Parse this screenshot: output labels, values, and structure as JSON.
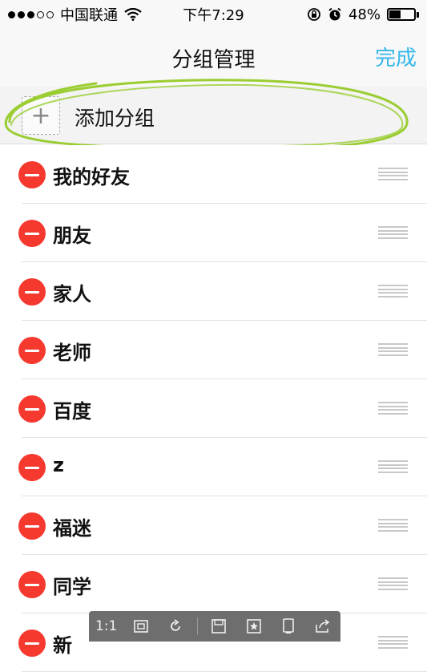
{
  "status_bar": {
    "carrier": "中国联通",
    "time": "下午7:29",
    "battery_percent": "48%",
    "battery_level": 0.48,
    "signal_bars_filled": 3,
    "signal_bars_total": 5,
    "icons": [
      "wifi-icon",
      "rotation-lock-icon",
      "alarm-icon",
      "battery-icon"
    ]
  },
  "nav": {
    "title": "分组管理",
    "done_label": "完成",
    "accent_color": "#35b7ea"
  },
  "add_group": {
    "plus": "+",
    "label": "添加分组"
  },
  "groups": [
    {
      "name": "我的好友"
    },
    {
      "name": "朋友"
    },
    {
      "name": "家人"
    },
    {
      "name": "老师"
    },
    {
      "name": "百度"
    },
    {
      "name": "z"
    },
    {
      "name": "福迷"
    },
    {
      "name": "同学"
    },
    {
      "name": "新"
    }
  ],
  "colors": {
    "delete": "#f6392f",
    "highlight_stroke": "#9acd32"
  },
  "viewer_toolbar": {
    "zoom_label": "1:1",
    "icons": [
      "fit-screen-icon",
      "rotate-icon",
      "save-icon",
      "favorite-icon",
      "device-icon",
      "share-icon"
    ]
  }
}
